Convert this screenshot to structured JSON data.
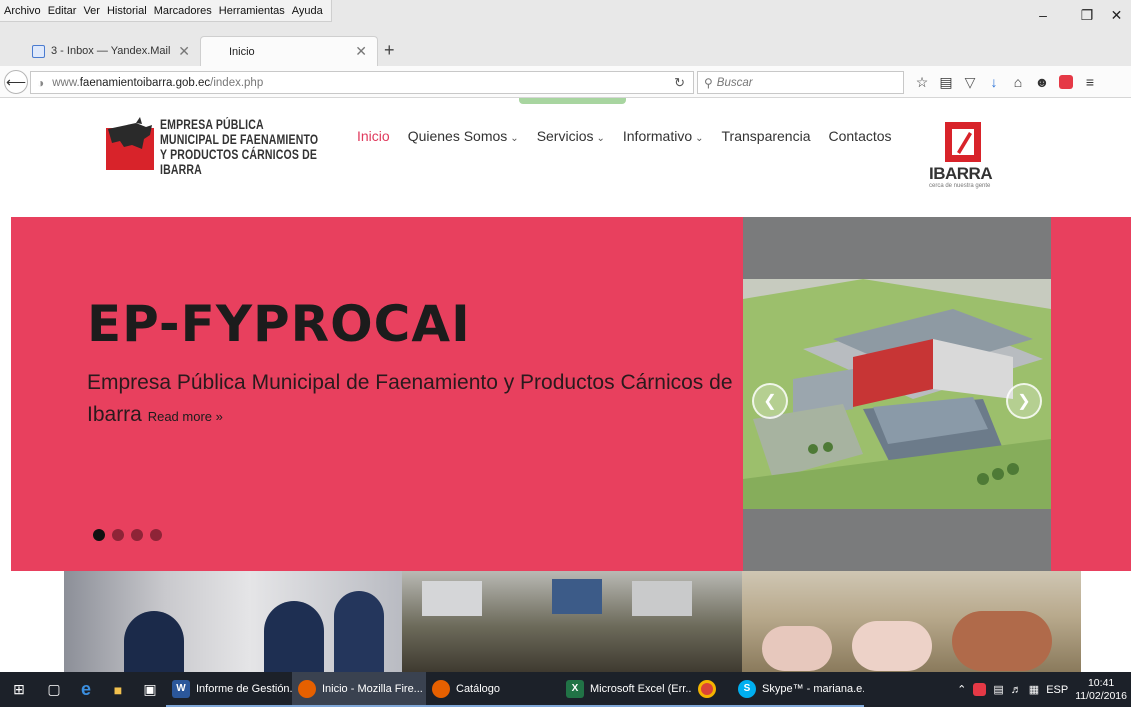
{
  "menubar": {
    "items": [
      "Archivo",
      "Editar",
      "Ver",
      "Historial",
      "Marcadores",
      "Herramientas",
      "Ayuda"
    ]
  },
  "window_controls": {
    "minimize": "–",
    "maximize": "❐",
    "close": "✕"
  },
  "tabs": [
    {
      "label": "3 - Inbox — Yandex.Mail",
      "close": "✕"
    },
    {
      "label": "Inicio",
      "close": "✕"
    }
  ],
  "new_tab_label": "+",
  "navbar": {
    "url_prefix": "www.",
    "url_domain": "faenamientoibarra.gob.ec",
    "url_path": "/index.php",
    "search_placeholder": "Buscar"
  },
  "site": {
    "logo_lines": [
      "EMPRESA PÚBLICA",
      "MUNICIPAL DE FAENAMIENTO",
      "Y PRODUCTOS CÁRNICOS DE IBARRA"
    ],
    "nav": [
      {
        "label": "Inicio",
        "caret": ""
      },
      {
        "label": "Quienes Somos",
        "caret": "⌄"
      },
      {
        "label": "Servicios",
        "caret": "⌄"
      },
      {
        "label": "Informativo",
        "caret": "⌄"
      },
      {
        "label": "Transparencia",
        "caret": ""
      },
      {
        "label": "Contactos",
        "caret": ""
      }
    ],
    "partner_logo": {
      "name": "IBARRA",
      "tagline": "cerca de nuestra gente"
    },
    "hero": {
      "title": "EP-FYPROCAI",
      "subtitle": "Empresa Pública Municipal de Faenamiento y Productos Cárnicos de Ibarra",
      "read_more": "Read more »",
      "slide_count": 4,
      "active_slide": 1
    },
    "colors": {
      "hero_bg": "#e8405e",
      "accent": "#e03a5d"
    }
  },
  "taskbar": {
    "tasks": [
      {
        "label": "Informe de Gestión...",
        "icon": "word-icon",
        "badge": "W"
      },
      {
        "label": "Inicio - Mozilla Fire...",
        "icon": "firefox-icon",
        "badge": ""
      },
      {
        "label": "Catálogo",
        "icon": "firefox-icon",
        "badge": ""
      },
      {
        "label": "Microsoft Excel (Err...",
        "icon": "excel-icon",
        "badge": "X"
      },
      {
        "label": "",
        "icon": "chrome-icon",
        "badge": ""
      },
      {
        "label": "Skype™ - mariana.e...",
        "icon": "skype-icon",
        "badge": "S"
      }
    ],
    "language": "ESP",
    "time": "10:41",
    "date": "11/02/2016"
  }
}
